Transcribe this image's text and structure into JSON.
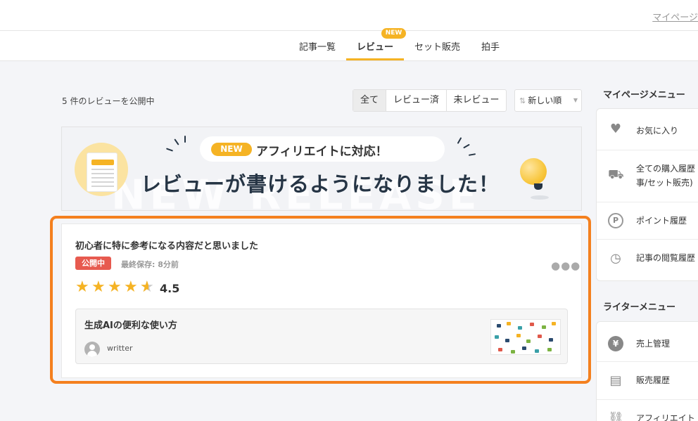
{
  "header": {
    "mypage_link": "マイページ"
  },
  "tabs": {
    "items": [
      "記事一覧",
      "レビュー",
      "セット販売",
      "拍手"
    ],
    "new_badge": "NEW"
  },
  "reviews": {
    "count_text": "5 件のレビューを公開中",
    "filters": [
      "全て",
      "レビュー済",
      "未レビュー"
    ],
    "sort_label": "新しい順"
  },
  "banner": {
    "new_label": "NEW",
    "pill_text": "アフィリエイトに対応！",
    "main_text": "レビューが書けるようになりました！",
    "watermark": "NEW RELEASE"
  },
  "review": {
    "title": "初心者に特に参考になる内容だと思いました",
    "status": "公開中",
    "saved": "最終保存: 8分前",
    "rating": 4.5,
    "rating_label": "4.5",
    "article": {
      "title": "生成AIの便利な使い方",
      "author": "writter"
    }
  },
  "sidebar": {
    "mypage_heading": "マイページメニュー",
    "mypage_items": [
      {
        "label": "お気に入り",
        "icon": "heart-icon"
      },
      {
        "label": "全ての購入履歴",
        "label2": "事/セット販売)",
        "icon": "cart-icon"
      },
      {
        "label": "ポイント履歴",
        "icon": "point-icon"
      },
      {
        "label": "記事の閲覧履歴",
        "icon": "clock-icon"
      }
    ],
    "writer_heading": "ライターメニュー",
    "writer_items": [
      {
        "label": "売上管理",
        "icon": "yen-icon"
      },
      {
        "label": "販売履歴",
        "icon": "sales-history-icon"
      },
      {
        "label": "アフィリエイト",
        "icon": "link-icon"
      }
    ]
  },
  "colors": {
    "accent": "#f5b324",
    "highlight": "#f4801f",
    "status": "#e75a4f"
  }
}
